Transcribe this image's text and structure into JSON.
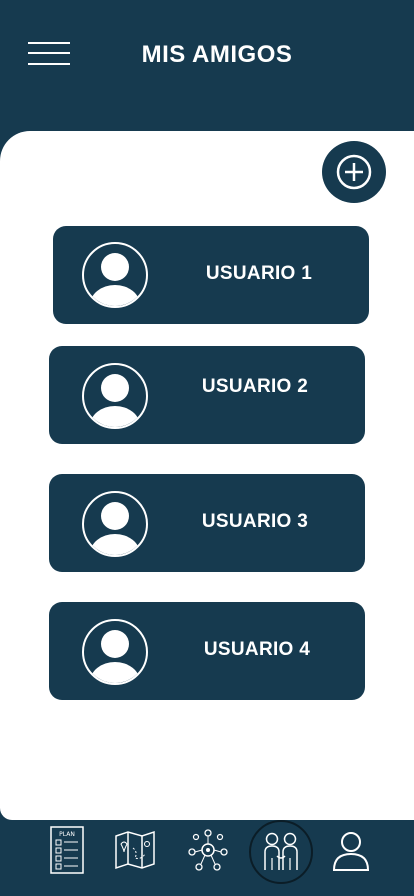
{
  "header": {
    "title": "MIS AMIGOS",
    "menu_icon": "hamburger-menu-icon"
  },
  "actions": {
    "add_icon": "plus-circle-icon"
  },
  "users": [
    {
      "label": "USUARIO 1",
      "icon": "user-avatar-icon"
    },
    {
      "label": "USUARIO 2",
      "icon": "user-avatar-icon"
    },
    {
      "label": "USUARIO 3",
      "icon": "user-avatar-icon"
    },
    {
      "label": "USUARIO 4",
      "icon": "user-avatar-icon"
    }
  ],
  "bottom_nav": {
    "items": [
      {
        "icon": "plan-icon",
        "label": "PLAN"
      },
      {
        "icon": "map-icon"
      },
      {
        "icon": "network-icon"
      },
      {
        "icon": "friends-icon",
        "active": true
      },
      {
        "icon": "profile-icon"
      }
    ]
  },
  "colors": {
    "primary": "#163a4f",
    "background": "#ffffff",
    "text_on_primary": "#ffffff"
  }
}
